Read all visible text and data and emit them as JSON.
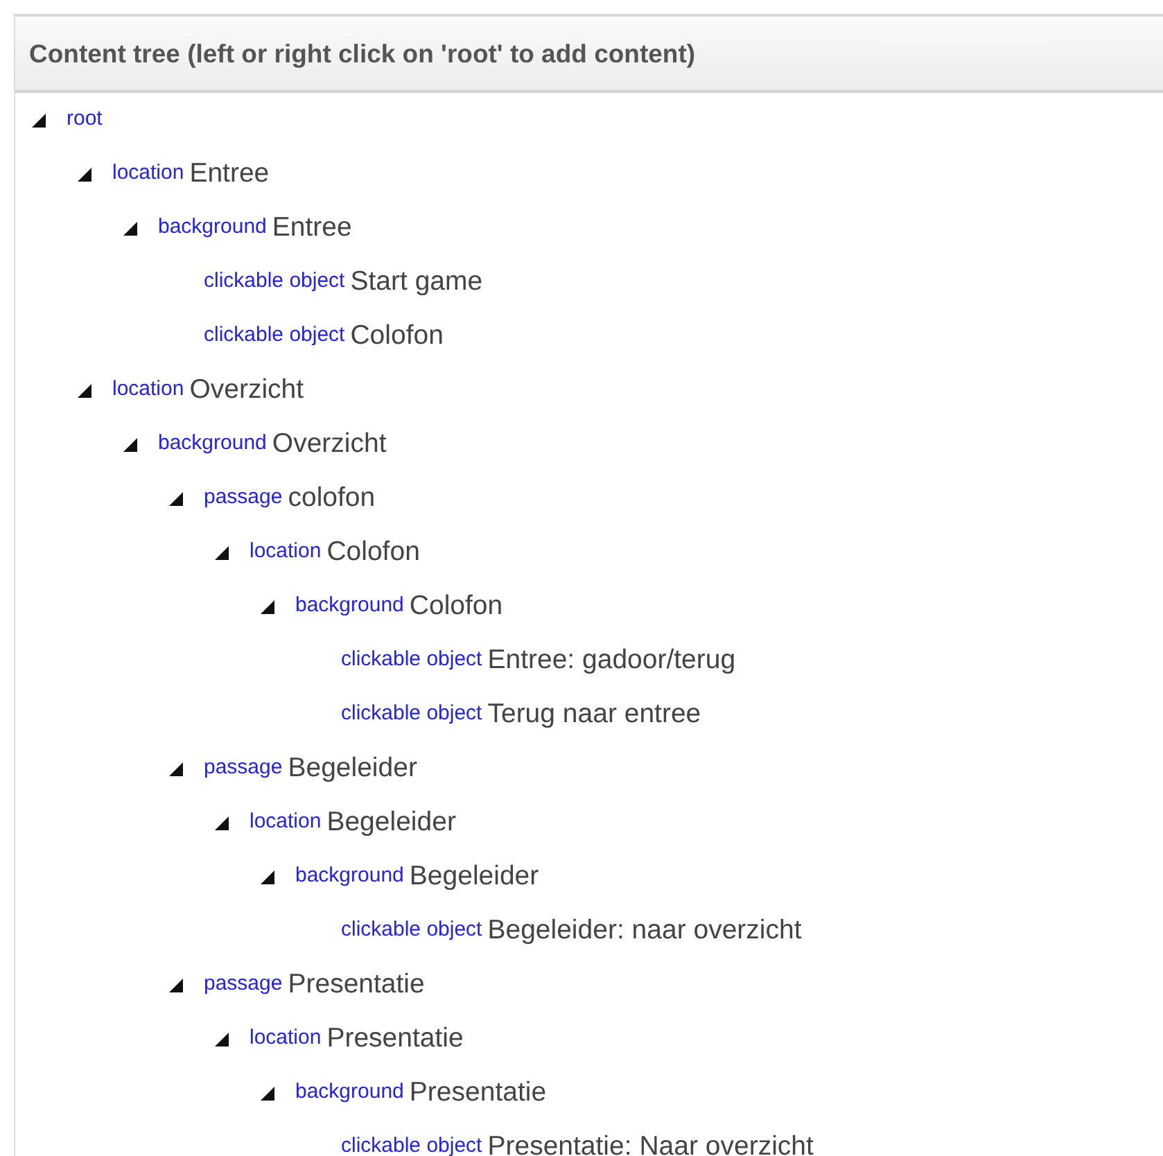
{
  "panel": {
    "title": "Content tree (left or right click on 'root' to add content)"
  },
  "tree": [
    {
      "type": "root",
      "expanded": true,
      "children": [
        {
          "type": "location",
          "name": "Entree",
          "expanded": true,
          "children": [
            {
              "type": "background",
              "name": "Entree",
              "expanded": true,
              "children": [
                {
                  "type": "clickable object",
                  "name": "Start game"
                },
                {
                  "type": "clickable object",
                  "name": "Colofon"
                }
              ]
            }
          ]
        },
        {
          "type": "location",
          "name": "Overzicht",
          "expanded": true,
          "children": [
            {
              "type": "background",
              "name": "Overzicht",
              "expanded": true,
              "children": [
                {
                  "type": "passage",
                  "name": "colofon",
                  "expanded": true,
                  "children": [
                    {
                      "type": "location",
                      "name": "Colofon",
                      "expanded": true,
                      "children": [
                        {
                          "type": "background",
                          "name": "Colofon",
                          "expanded": true,
                          "children": [
                            {
                              "type": "clickable object",
                              "name": "Entree: gadoor/terug"
                            },
                            {
                              "type": "clickable object",
                              "name": "Terug naar entree"
                            }
                          ]
                        }
                      ]
                    }
                  ]
                },
                {
                  "type": "passage",
                  "name": "Begeleider",
                  "expanded": true,
                  "children": [
                    {
                      "type": "location",
                      "name": "Begeleider",
                      "expanded": true,
                      "children": [
                        {
                          "type": "background",
                          "name": "Begeleider",
                          "expanded": true,
                          "children": [
                            {
                              "type": "clickable object",
                              "name": "Begeleider: naar overzicht"
                            }
                          ]
                        }
                      ]
                    }
                  ]
                },
                {
                  "type": "passage",
                  "name": "Presentatie",
                  "expanded": true,
                  "children": [
                    {
                      "type": "location",
                      "name": "Presentatie",
                      "expanded": true,
                      "children": [
                        {
                          "type": "background",
                          "name": "Presentatie",
                          "expanded": true,
                          "children": [
                            {
                              "type": "clickable object",
                              "name": "Presentatie: Naar overzicht"
                            }
                          ]
                        }
                      ]
                    }
                  ]
                }
              ]
            }
          ]
        }
      ]
    }
  ]
}
